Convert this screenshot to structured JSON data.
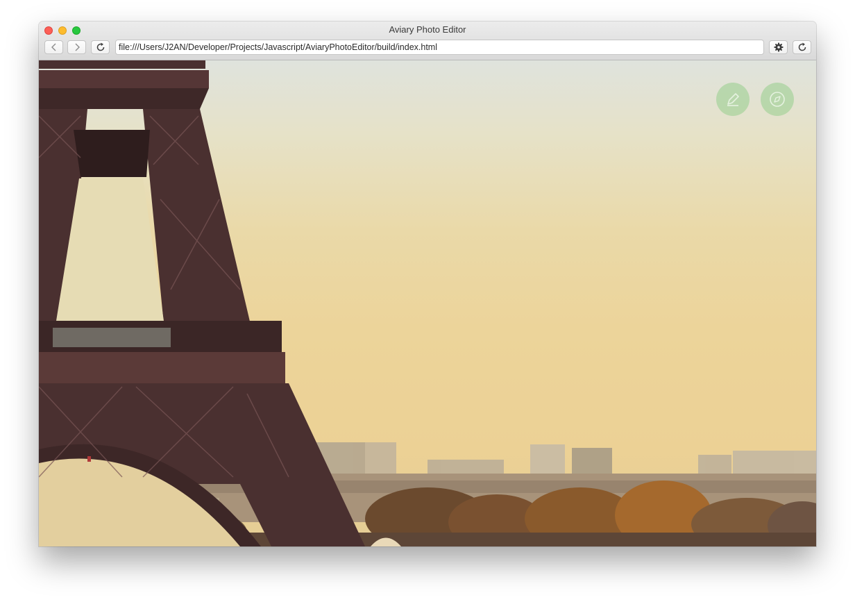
{
  "window": {
    "title": "Aviary Photo Editor",
    "url": "file:///Users/J2AN/Developer/Projects/Javascript/AviaryPhotoEditor/build/index.html"
  },
  "toolbar": {
    "back_icon": "chevron-left-icon",
    "forward_icon": "chevron-right-icon",
    "reload_icon": "reload-icon",
    "settings_icon": "gear-icon",
    "refresh_icon": "reload-icon"
  },
  "overlay_buttons": {
    "edit_icon": "pencil-icon",
    "explore_icon": "compass-icon",
    "color": "#96cd8c"
  },
  "colors": {
    "close": "#fc5f57",
    "minimize": "#fdbc2e",
    "maximize": "#28c840"
  }
}
